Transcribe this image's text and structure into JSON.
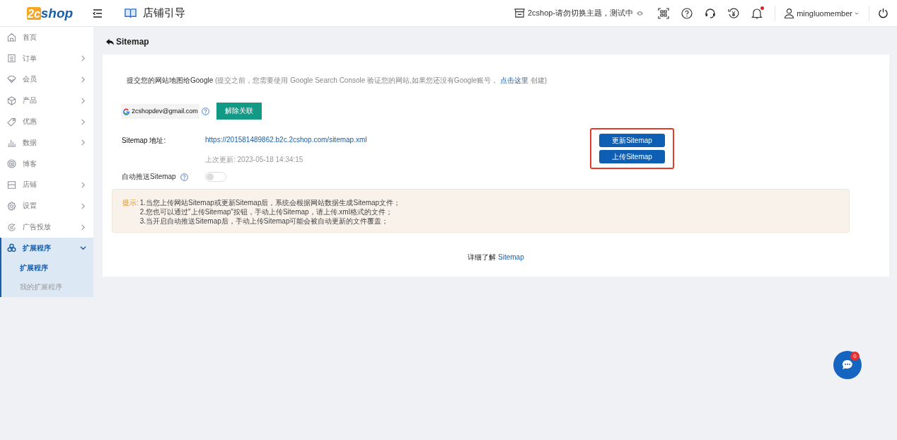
{
  "header": {
    "logo": {
      "mark": "2c",
      "word": "shop"
    },
    "page_title": "店铺引导",
    "store_name": "2cshop-请勿切换主题，测试中",
    "username": "mingluomember",
    "notifications_unread": true
  },
  "sidebar": {
    "items": [
      {
        "label": "首页",
        "selected": false
      },
      {
        "label": "订单",
        "expanded": false,
        "selected": false
      },
      {
        "label": "会员",
        "expanded": false,
        "selected": false
      },
      {
        "label": "产品",
        "expanded": false,
        "selected": false
      },
      {
        "label": "优惠",
        "expanded": false,
        "selected": false
      },
      {
        "label": "数据",
        "expanded": false,
        "selected": false
      },
      {
        "label": "博客",
        "selected": false
      },
      {
        "label": "店铺",
        "expanded": false,
        "selected": false
      },
      {
        "label": "设置",
        "expanded": false,
        "selected": false
      },
      {
        "label": "广告投放",
        "expanded": false,
        "selected": false
      },
      {
        "label": "扩展程序",
        "expanded": true,
        "selected": true,
        "children": [
          {
            "label": "扩展程序",
            "selected": true
          },
          {
            "label": "我的扩展程序",
            "selected": false
          }
        ]
      }
    ]
  },
  "page": {
    "title": "Sitemap",
    "intro": {
      "lead": "提交您的网站地图给Google",
      "note_before": "(提交之前，您需要使用 Google Search Console 验证您的网站,如果您还没有Google账号，",
      "link": "点击这里",
      "note_after": "创建)"
    },
    "google_account": "2cshopdev@gmail.com",
    "unlink_button": "解除关联",
    "sitemap_label": "Sitemap 地址:",
    "sitemap_url": "https://201581489862.b2c.2cshop.com/sitemap.xml",
    "last_updated": "上次更新: 2023-05-18 14:34:15",
    "buttons": [
      {
        "label": "更新Sitemap"
      },
      {
        "label": "上传Sitemap"
      }
    ],
    "buttons_highlighted": true,
    "auto_push": {
      "label": "自动推送Sitemap",
      "on": false
    },
    "tips": {
      "label": "提示:",
      "lines": [
        "1.当您上传网站Sitemap或更新Sitemap后，系统会根据网站数据生成Sitemap文件；",
        "2.您也可以通过\"上传Sitemap\"按钮，手动上传Sitemap，请上传.xml格式的文件；",
        "3.当开启自动推送Sitemap后，手动上传Sitemap可能会被自动更新的文件覆盖；"
      ]
    },
    "learn_more": {
      "text": "详细了解",
      "link": "Sitemap"
    }
  },
  "chat": {
    "badge": "0"
  }
}
